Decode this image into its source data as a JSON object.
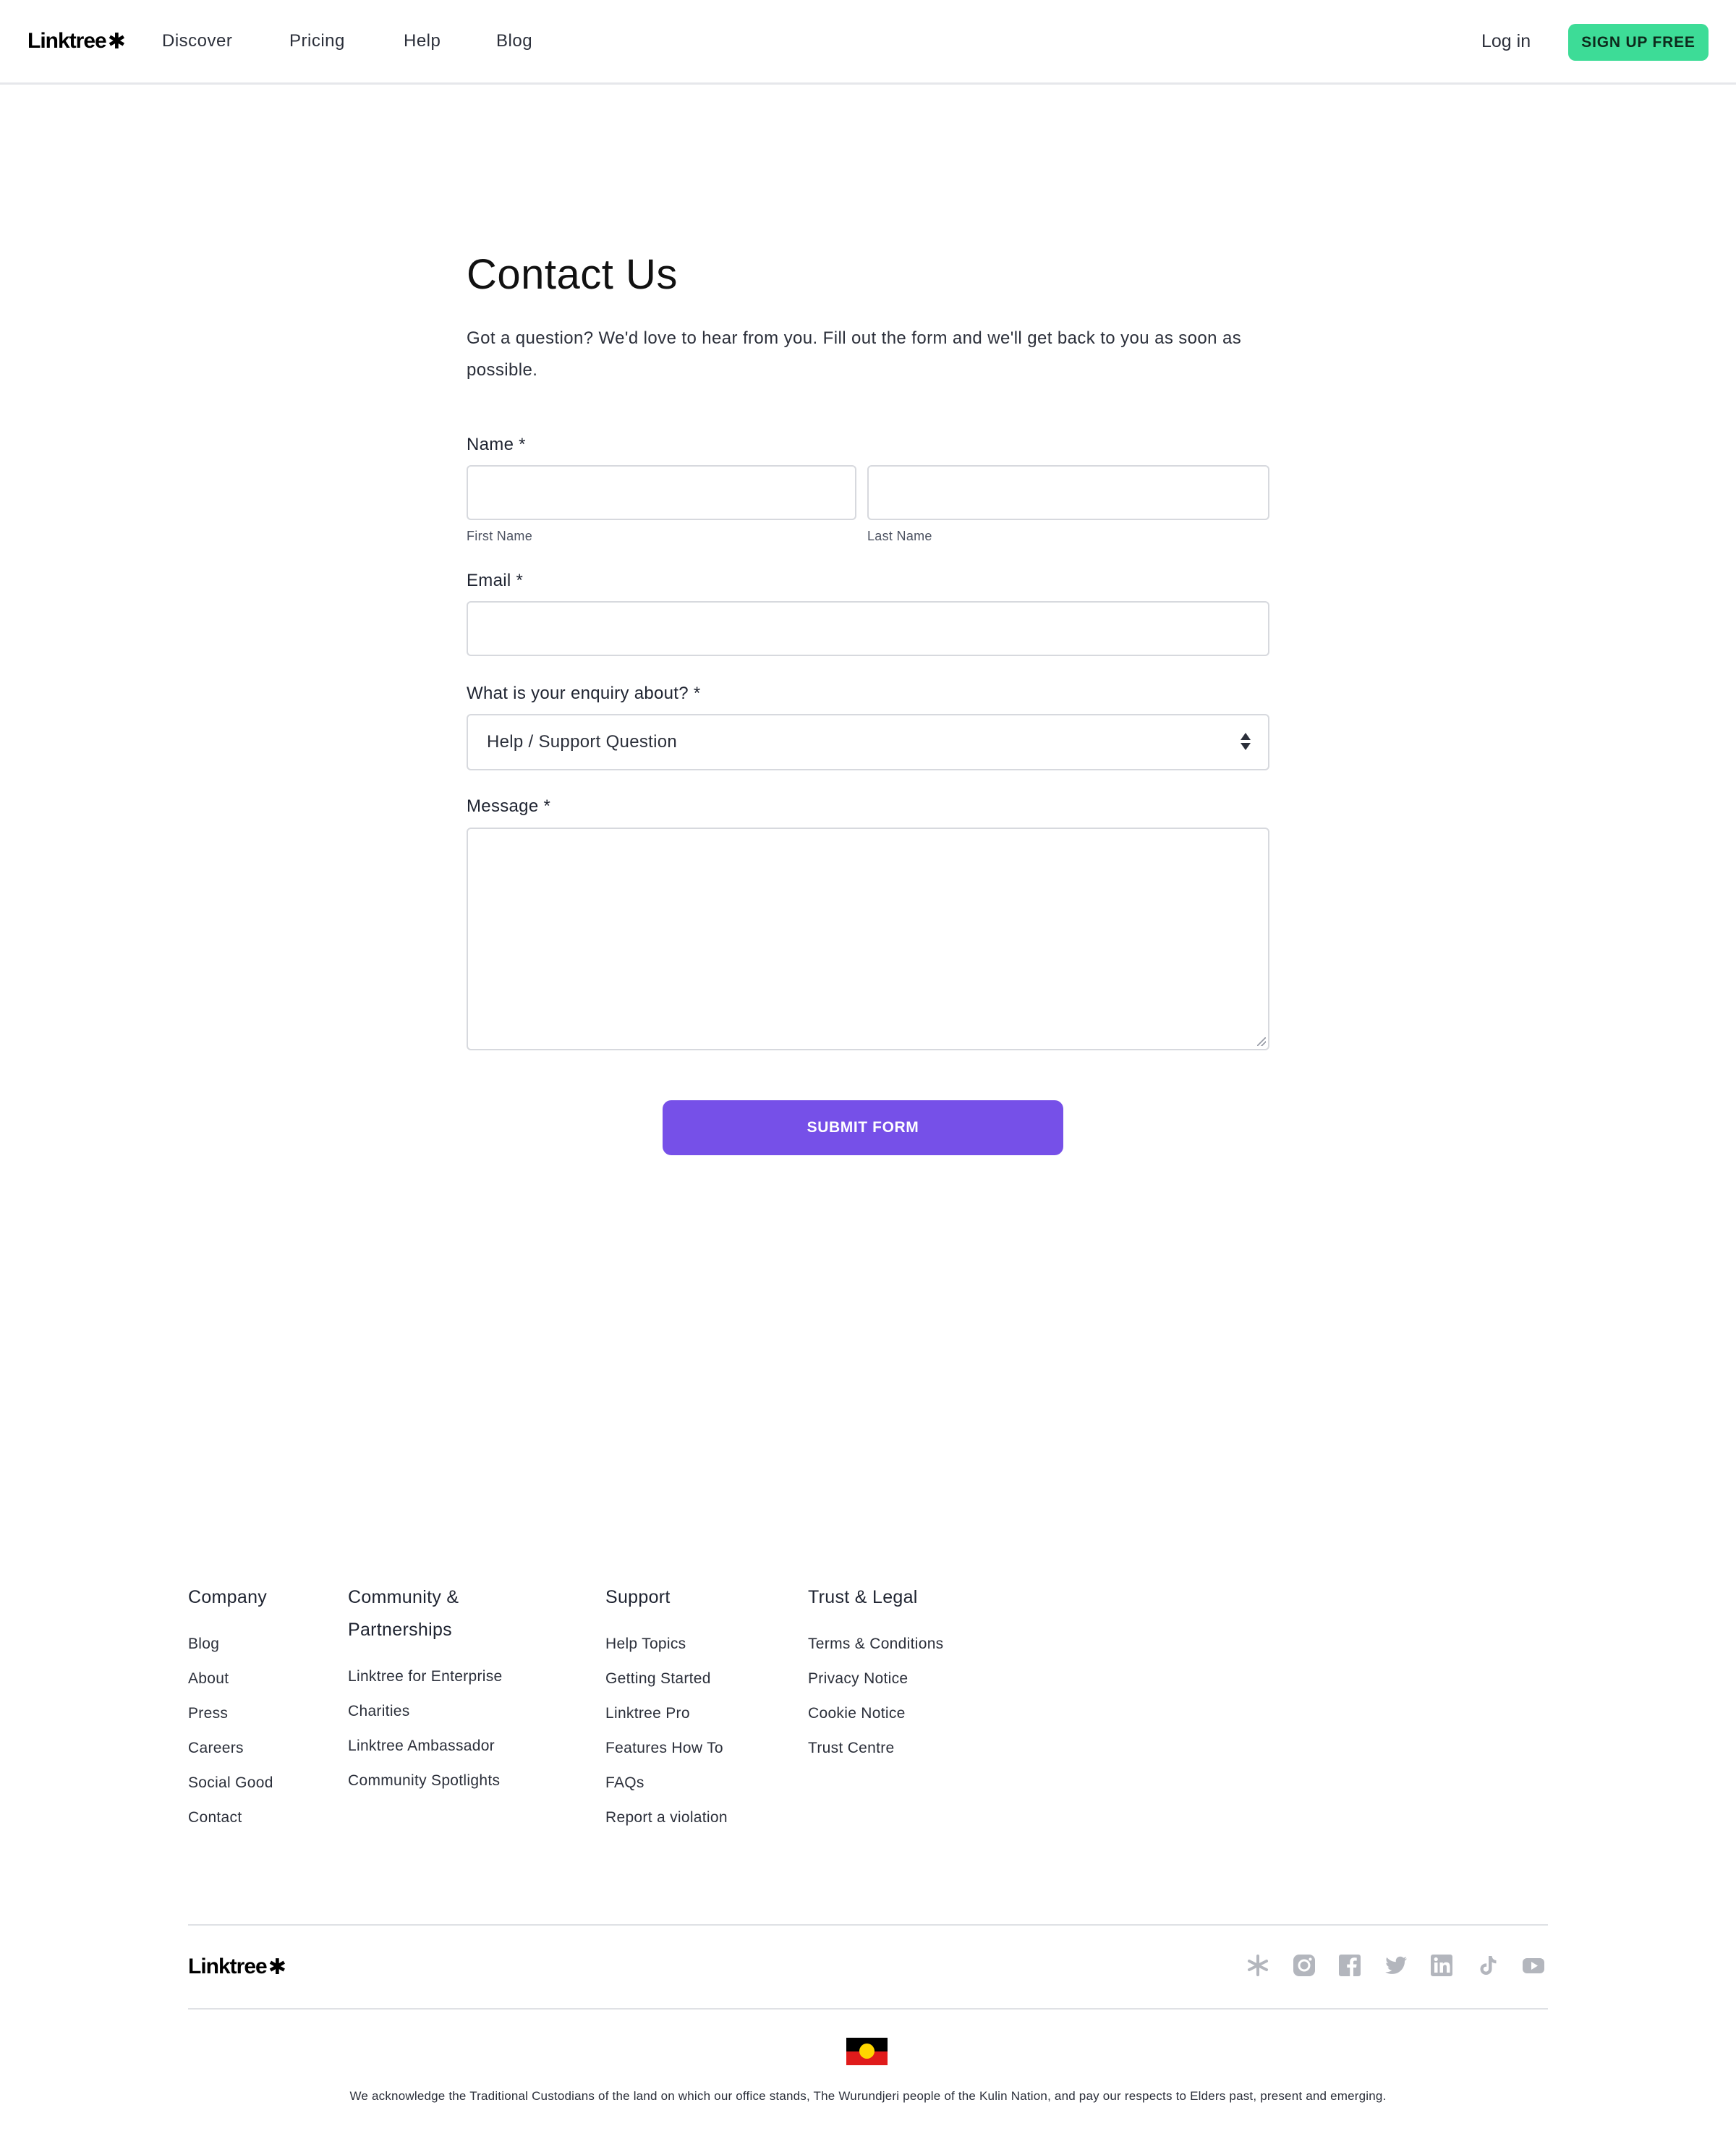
{
  "header": {
    "logo": "Linktree",
    "logo_glyph": "✱",
    "nav": [
      "Discover",
      "Pricing",
      "Help",
      "Blog"
    ],
    "login": "Log in",
    "signup": "SIGN UP FREE"
  },
  "form": {
    "title": "Contact Us",
    "intro": "Got a question? We'd love to hear from you. Fill out the form and we'll get back to you as soon as possible.",
    "name_label": "Name *",
    "first_name_hint": "First Name",
    "last_name_hint": "Last Name",
    "first_name_value": "",
    "last_name_value": "",
    "email_label": "Email *",
    "email_value": "",
    "enquiry_label": "What is your enquiry about? *",
    "enquiry_selected": "Help / Support Question",
    "message_label": "Message *",
    "message_value": "",
    "submit": "SUBMIT FORM"
  },
  "footer": {
    "columns": [
      {
        "heading": "Company",
        "links": [
          "Blog",
          "About",
          "Press",
          "Careers",
          "Social Good",
          "Contact"
        ]
      },
      {
        "heading": "Community & Partnerships",
        "links": [
          "Linktree for Enterprise",
          "Charities",
          "Linktree Ambassador",
          "Community Spotlights"
        ]
      },
      {
        "heading": "Support",
        "links": [
          "Help Topics",
          "Getting Started",
          "Linktree Pro",
          "Features How To",
          "FAQs",
          "Report a violation"
        ]
      },
      {
        "heading": "Trust & Legal",
        "links": [
          "Terms & Conditions",
          "Privacy Notice",
          "Cookie Notice",
          "Trust Centre"
        ]
      }
    ],
    "logo": "Linktree",
    "logo_glyph": "✱",
    "socials": [
      "linktree-icon",
      "instagram-icon",
      "facebook-icon",
      "twitter-icon",
      "linkedin-icon",
      "tiktok-icon",
      "youtube-icon"
    ],
    "acknowledgement": "We acknowledge the Traditional Custodians of the land on which our office stands, The Wurundjeri people of the Kulin Nation, and pay our respects to Elders past, present and emerging."
  },
  "colors": {
    "signup_green": "#3ddc97",
    "submit_purple": "#7650e8",
    "social_grey": "#b3b6bd"
  }
}
